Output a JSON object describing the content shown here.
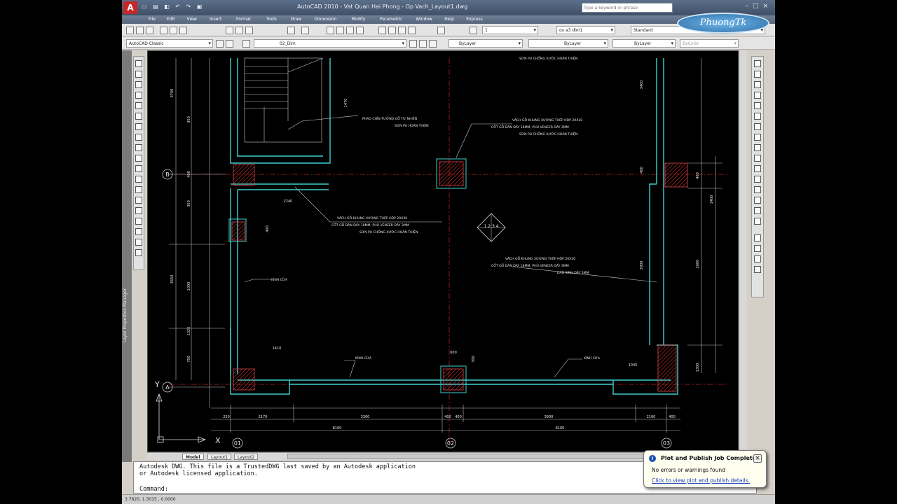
{
  "window": {
    "title": "AutoCAD 2010 - Vat Quan Hai Phong - Op Vach_Layout1.dwg",
    "search_placeholder": "Type a keyword or phrase",
    "logo_letter": "A"
  },
  "menu": [
    "File",
    "Edit",
    "View",
    "Insert",
    "Format",
    "Tools",
    "Draw",
    "Dimension",
    "Modify",
    "Parametric",
    "Window",
    "Help",
    "Express"
  ],
  "toolbar": {
    "dimstyle": "1",
    "textstyle": "ox a3 dim1",
    "tablestyle": "Standard",
    "workspace": "AutoCAD Classic",
    "layer": "02_Dim",
    "color": "ByLayer",
    "linetype": "ByLayer",
    "lineweight": "ByLayer",
    "plotstyle": "ByColor"
  },
  "watermark": "PhuongTk",
  "side_panel_label": "Layer Properties Manager",
  "drawing": {
    "grid_bubbles": [
      "01",
      "02",
      "03",
      "B",
      "A"
    ],
    "north_marks": "1 2 3 4",
    "notes": {
      "note_top_right": "SƠN PU CHỐNG XƯỚC HOÀN THIỆN",
      "note_mid_left_1": "PHAO CHỈN TƯỜNG GỖ TỰ NHIÊN",
      "note_mid_left_2": "SƠN PU HOÀN THIỆN",
      "note_right_a_1": "VÁCH GỖ KHUNG XƯƠNG THÉP HỘP 20X30",
      "note_right_a_2": "CỐT GỖ DÁN DÀY 18MM, PHỦ VENEER DÀY 3MM",
      "note_right_a_3": "SƠN PU CHỐNG XƯỚC HOÀN THIỆN",
      "note_center_1": "VÁCH GỖ KHUNG XƯƠNG THÉP HỘP 20X30",
      "note_center_2": "CỐT GỖ DÁN DÀY 18MM, PHỦ VENEER DÀY 3MM",
      "note_center_3": "SƠN PU CHỐNG XƯỚC HOÀN THIỆN",
      "note_right_b_1": "VÁCH GỖ KHUNG XƯƠNG THÉP HỘP 20X30",
      "note_right_b_2": "CỐT GỖ DÁN DÀY 18MM, PHỦ VENEER DÀY 3MM",
      "note_right_b_3": "DÁN KÍNH DÀY 5MM",
      "label_kinh_cua_1": "KÍNH CỬA",
      "label_kinh_cua_2": "KÍNH CỬA",
      "label_kinh_cua_3": "KÍNH CỬA"
    },
    "dims_bottom": [
      "250",
      "2170",
      "3300",
      "400",
      "400",
      "3900",
      "2100",
      "400"
    ],
    "dims_bottom_total": [
      "8100",
      "8100"
    ],
    "dims_left": [
      "3700",
      "350",
      "400",
      "350",
      "3650",
      "1000",
      "750"
    ],
    "dims_right": [
      "3400",
      "400",
      "400",
      "1400",
      "3900",
      "2600",
      "1300"
    ],
    "dim_misc": [
      "2240",
      "600",
      "400",
      "1470",
      "1045",
      "300",
      "1410",
      "1325"
    ]
  },
  "tabs": [
    "Model",
    "Layout1",
    "Layout2"
  ],
  "command": {
    "line1": "Autodesk DWG.  This file is a TrustedDWG last saved by an Autodesk application",
    "line2": "or Autodesk licensed application.",
    "prompt": "Command:"
  },
  "status": {
    "coords": "3.7620, 1.3015 , 0.0000"
  },
  "notification": {
    "title": "Plot and Publish Job Complete",
    "message": "No errors or warnings found",
    "link": "Click to view plot and publish details."
  }
}
